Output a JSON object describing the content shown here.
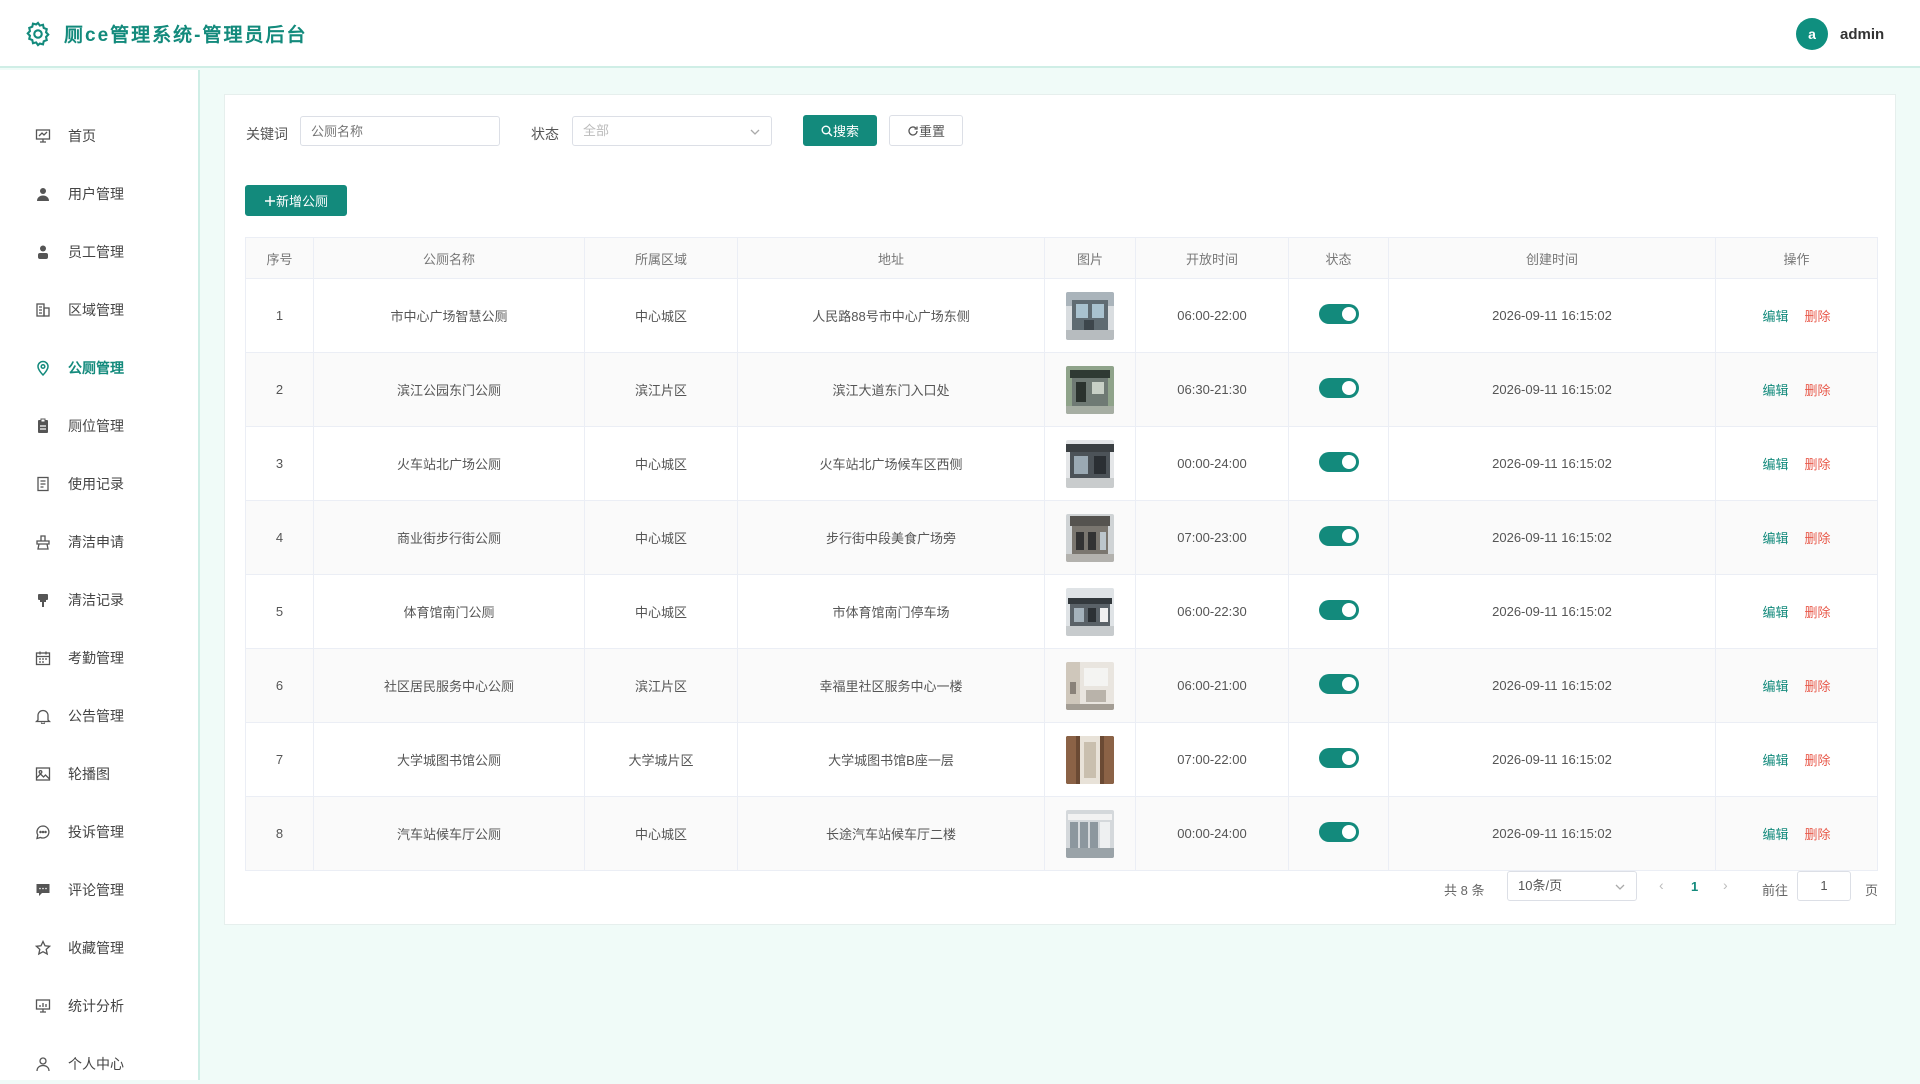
{
  "header": {
    "title": "厕ce管理系统-管理员后台",
    "avatar_letter": "a",
    "username": "admin",
    "logo_icon": "gear-icon"
  },
  "sidebar": {
    "items": [
      {
        "label": "首页",
        "icon": "presentation-icon"
      },
      {
        "label": "用户管理",
        "icon": "user-icon"
      },
      {
        "label": "员工管理",
        "icon": "user-solid-icon"
      },
      {
        "label": "区域管理",
        "icon": "office-building-icon"
      },
      {
        "label": "公厕管理",
        "icon": "location-icon"
      },
      {
        "label": "厕位管理",
        "icon": "clipboard-icon"
      },
      {
        "label": "使用记录",
        "icon": "document-icon"
      },
      {
        "label": "清洁申请",
        "icon": "cleaning-icon"
      },
      {
        "label": "清洁记录",
        "icon": "brush-icon"
      },
      {
        "label": "考勤管理",
        "icon": "calendar-icon"
      },
      {
        "label": "公告管理",
        "icon": "bell-icon"
      },
      {
        "label": "轮播图",
        "icon": "picture-icon"
      },
      {
        "label": "投诉管理",
        "icon": "chat-dots-icon"
      },
      {
        "label": "评论管理",
        "icon": "comment-icon"
      },
      {
        "label": "收藏管理",
        "icon": "star-icon"
      },
      {
        "label": "统计分析",
        "icon": "data-analysis-icon"
      },
      {
        "label": "个人中心",
        "icon": "person-icon"
      }
    ],
    "active_index": 4
  },
  "filters": {
    "keyword_label": "关键词",
    "keyword_placeholder": "公厕名称",
    "status_label": "状态",
    "status_value": "全部",
    "search_button": "搜索",
    "reset_button": "重置"
  },
  "add_button": "新增公厕",
  "table": {
    "headers": [
      "序号",
      "公厕名称",
      "所属区域",
      "地址",
      "图片",
      "开放时间",
      "状态",
      "创建时间",
      "操作"
    ],
    "edit_label": "编辑",
    "delete_label": "删除",
    "rows": [
      {
        "index": "1",
        "name": "市中心广场智慧公厕",
        "region": "中心城区",
        "address": "人民路88号市中心广场东侧",
        "hours": "06:00-22:00",
        "enabled": true,
        "created": "2026-09-11 16:15:02"
      },
      {
        "index": "2",
        "name": "滨江公园东门公厕",
        "region": "滨江片区",
        "address": "滨江大道东门入口处",
        "hours": "06:30-21:30",
        "enabled": true,
        "created": "2026-09-11 16:15:02"
      },
      {
        "index": "3",
        "name": "火车站北广场公厕",
        "region": "中心城区",
        "address": "火车站北广场候车区西侧",
        "hours": "00:00-24:00",
        "enabled": true,
        "created": "2026-09-11 16:15:02"
      },
      {
        "index": "4",
        "name": "商业街步行街公厕",
        "region": "中心城区",
        "address": "步行街中段美食广场旁",
        "hours": "07:00-23:00",
        "enabled": true,
        "created": "2026-09-11 16:15:02"
      },
      {
        "index": "5",
        "name": "体育馆南门公厕",
        "region": "中心城区",
        "address": "市体育馆南门停车场",
        "hours": "06:00-22:30",
        "enabled": true,
        "created": "2026-09-11 16:15:02"
      },
      {
        "index": "6",
        "name": "社区居民服务中心公厕",
        "region": "滨江片区",
        "address": "幸福里社区服务中心一楼",
        "hours": "06:00-21:00",
        "enabled": true,
        "created": "2026-09-11 16:15:02"
      },
      {
        "index": "7",
        "name": "大学城图书馆公厕",
        "region": "大学城片区",
        "address": "大学城图书馆B座一层",
        "hours": "07:00-22:00",
        "enabled": true,
        "created": "2026-09-11 16:15:02"
      },
      {
        "index": "8",
        "name": "汽车站候车厅公厕",
        "region": "中心城区",
        "address": "长途汽车站候车厅二楼",
        "hours": "00:00-24:00",
        "enabled": true,
        "created": "2026-09-11 16:15:02"
      }
    ]
  },
  "pagination": {
    "total_text": "共 8 条",
    "page_size": "10条/页",
    "current_page": "1",
    "goto_label": "前往",
    "goto_value": "1",
    "page_suffix": "页"
  },
  "colors": {
    "primary": "#138a7c",
    "danger": "#e8594a",
    "background": "#f0fbf8"
  }
}
